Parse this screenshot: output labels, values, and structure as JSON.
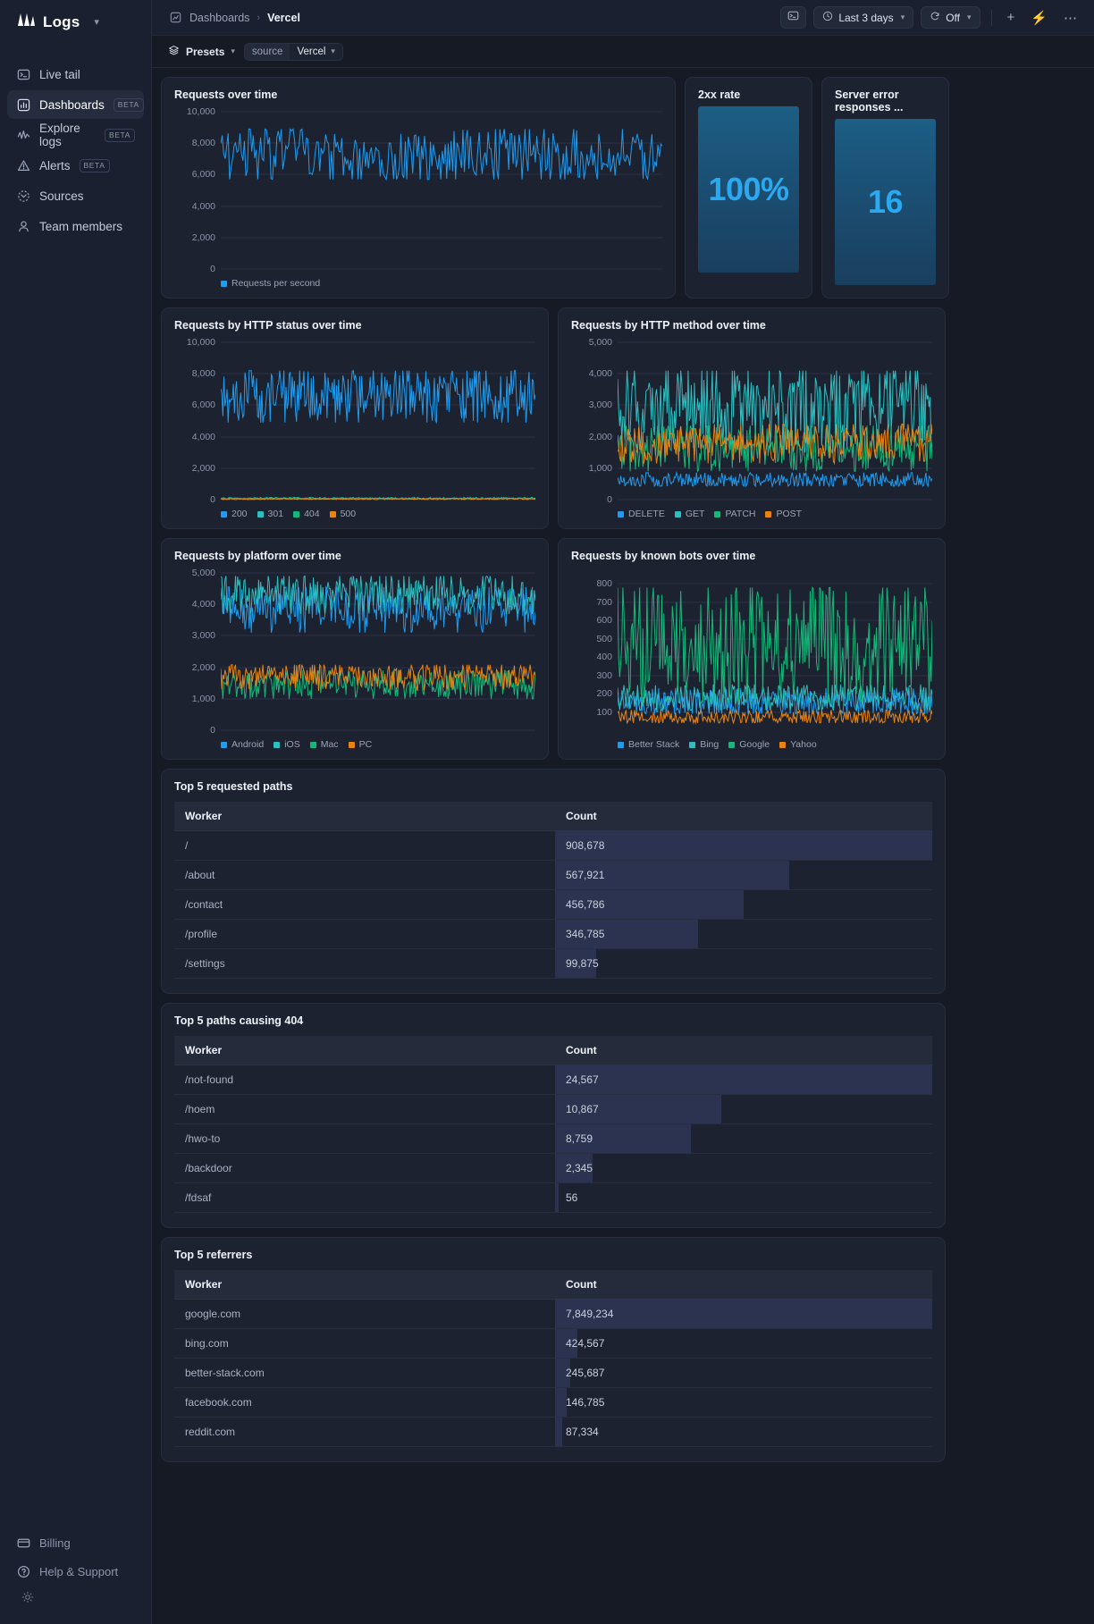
{
  "brand": {
    "name": "Logs",
    "caret": "chevron-down"
  },
  "sidebar": {
    "items": [
      {
        "label": "Live tail",
        "icon": "terminal-icon",
        "badge": "",
        "active": false
      },
      {
        "label": "Dashboards",
        "icon": "bar-chart-icon",
        "badge": "BETA",
        "active": true
      },
      {
        "label": "Explore logs",
        "icon": "activity-icon",
        "badge": "BETA",
        "active": false
      },
      {
        "label": "Alerts",
        "icon": "warning-triangle-icon",
        "badge": "BETA",
        "active": false
      },
      {
        "label": "Sources",
        "icon": "sources-icon",
        "badge": "",
        "active": false
      },
      {
        "label": "Team members",
        "icon": "user-icon",
        "badge": "",
        "active": false
      }
    ],
    "bottom": [
      {
        "label": "Billing",
        "icon": "credit-card-icon"
      },
      {
        "label": "Help & Support",
        "icon": "question-circle-icon"
      }
    ],
    "theme_toggle": "sun-icon"
  },
  "topbar": {
    "breadcrumb_root": "Dashboards",
    "breadcrumb_sep": "›",
    "breadcrumb_current": "Vercel",
    "console_button": "terminal-icon",
    "time_range": "Last 3 days",
    "refresh_label": "Off",
    "add_label": "+",
    "live_label": "⚡",
    "more_label": "⋯"
  },
  "filterbar": {
    "presets_label": "Presets",
    "filter_key": "source",
    "filter_value": "Vercel"
  },
  "chart_data": [
    {
      "id": "requests-over-time",
      "type": "line",
      "title": "Requests over time",
      "ylabel": "",
      "xlabel": "",
      "yticks": [
        10000,
        8000,
        6000,
        4000,
        2000,
        0
      ],
      "ytick_labels": [
        "10,000",
        "8,000",
        "6,000",
        "4,000",
        "2,000",
        "0"
      ],
      "ylim": [
        0,
        10000
      ],
      "grid": true,
      "legend_position": "bottom",
      "series": [
        {
          "name": "Requests per second",
          "color": "#1f9cf0",
          "mean": 7200,
          "min": 5700,
          "max": 8900
        }
      ]
    },
    {
      "id": "2xx-rate",
      "type": "number",
      "title": "2xx rate",
      "value": "100%",
      "value_color": "#2aa9f0"
    },
    {
      "id": "server-error-responses",
      "type": "number",
      "title": "Server error responses ...",
      "value": "16",
      "value_color": "#2aa9f0"
    },
    {
      "id": "requests-by-http-status",
      "type": "line",
      "title": "Requests by HTTP status over time",
      "yticks": [
        10000,
        8000,
        6000,
        4000,
        2000,
        0
      ],
      "ytick_labels": [
        "10,000",
        "8,000",
        "6,000",
        "4,000",
        "2,000",
        "0"
      ],
      "ylim": [
        0,
        10000
      ],
      "grid": true,
      "legend_position": "bottom",
      "series": [
        {
          "name": "200",
          "color": "#1f9cf0",
          "mean": 6700,
          "min": 4900,
          "max": 8200
        },
        {
          "name": "301",
          "color": "#2dbfc0",
          "mean": 60,
          "min": 20,
          "max": 110
        },
        {
          "name": "404",
          "color": "#14b87a",
          "mean": 90,
          "min": 30,
          "max": 150
        },
        {
          "name": "500",
          "color": "#e98413",
          "mean": 40,
          "min": 5,
          "max": 90
        }
      ]
    },
    {
      "id": "requests-by-http-method",
      "type": "line",
      "title": "Requests by HTTP method over time",
      "yticks": [
        5000,
        4000,
        3000,
        2000,
        1000,
        0
      ],
      "ytick_labels": [
        "5,000",
        "4,000",
        "3,000",
        "2,000",
        "1,000",
        "0"
      ],
      "ylim": [
        0,
        5000
      ],
      "grid": true,
      "legend_position": "bottom",
      "series": [
        {
          "name": "DELETE",
          "color": "#1f9cf0",
          "mean": 620,
          "min": 430,
          "max": 860
        },
        {
          "name": "GET",
          "color": "#2dbfc0",
          "mean": 2950,
          "min": 1500,
          "max": 4100
        },
        {
          "name": "PATCH",
          "color": "#14b87a",
          "mean": 1700,
          "min": 900,
          "max": 2350
        },
        {
          "name": "POST",
          "color": "#e98413",
          "mean": 1850,
          "min": 1150,
          "max": 2400
        }
      ]
    },
    {
      "id": "requests-by-platform",
      "type": "line",
      "title": "Requests by platform over time",
      "yticks": [
        5000,
        4000,
        3000,
        2000,
        1000,
        0
      ],
      "ytick_labels": [
        "5,000",
        "4,000",
        "3,000",
        "2,000",
        "1,000",
        "0"
      ],
      "ylim": [
        0,
        5000
      ],
      "grid": true,
      "legend_position": "bottom",
      "series": [
        {
          "name": "Android",
          "color": "#1f9cf0",
          "mean": 3850,
          "min": 3100,
          "max": 4550
        },
        {
          "name": "iOS",
          "color": "#2dbfc0",
          "mean": 4350,
          "min": 3700,
          "max": 4900
        },
        {
          "name": "Mac",
          "color": "#14b87a",
          "mean": 1450,
          "min": 1000,
          "max": 1900
        },
        {
          "name": "PC",
          "color": "#e98413",
          "mean": 1750,
          "min": 1250,
          "max": 2080
        }
      ]
    },
    {
      "id": "requests-by-known-bots",
      "type": "line",
      "title": "Requests by known bots over time",
      "yticks": [
        800,
        700,
        600,
        500,
        400,
        300,
        200,
        100
      ],
      "ytick_labels": [
        "800",
        "700",
        "600",
        "500",
        "400",
        "300",
        "200",
        "100"
      ],
      "ylim": [
        0,
        860
      ],
      "grid": true,
      "legend_position": "bottom",
      "series": [
        {
          "name": "Better Stack",
          "color": "#1f9cf0",
          "mean": 150,
          "min": 90,
          "max": 230
        },
        {
          "name": "Bing",
          "color": "#2dbfc0",
          "mean": 175,
          "min": 110,
          "max": 250
        },
        {
          "name": "Google",
          "color": "#14b87a",
          "mean": 480,
          "min": 150,
          "max": 780
        },
        {
          "name": "Yahoo",
          "color": "#e98413",
          "mean": 70,
          "min": 40,
          "max": 110
        }
      ]
    }
  ],
  "tables": [
    {
      "id": "top-5-requested-paths",
      "title": "Top 5 requested paths",
      "columns": [
        "Worker",
        "Count"
      ],
      "rows": [
        {
          "worker": "/",
          "count": "908,678",
          "pct": 100
        },
        {
          "worker": "/about",
          "count": "567,921",
          "pct": 62
        },
        {
          "worker": "/contact",
          "count": "456,786",
          "pct": 50
        },
        {
          "worker": "/profile",
          "count": "346,785",
          "pct": 38
        },
        {
          "worker": "/settings",
          "count": "99,875",
          "pct": 11
        }
      ]
    },
    {
      "id": "top-5-paths-causing-404",
      "title": "Top 5 paths causing 404",
      "columns": [
        "Worker",
        "Count"
      ],
      "rows": [
        {
          "worker": "/not-found",
          "count": "24,567",
          "pct": 100
        },
        {
          "worker": "/hoem",
          "count": "10,867",
          "pct": 44
        },
        {
          "worker": "/hwo-to",
          "count": "8,759",
          "pct": 36
        },
        {
          "worker": "/backdoor",
          "count": "2,345",
          "pct": 10
        },
        {
          "worker": "/fdsaf",
          "count": "56",
          "pct": 1
        }
      ]
    },
    {
      "id": "top-5-referrers",
      "title": "Top 5 referrers",
      "columns": [
        "Worker",
        "Count"
      ],
      "rows": [
        {
          "worker": "google.com",
          "count": "7,849,234",
          "pct": 100
        },
        {
          "worker": "bing.com",
          "count": "424,567",
          "pct": 6
        },
        {
          "worker": "better-stack.com",
          "count": "245,687",
          "pct": 4
        },
        {
          "worker": "facebook.com",
          "count": "146,785",
          "pct": 3
        },
        {
          "worker": "reddit.com",
          "count": "87,334",
          "pct": 2
        }
      ]
    }
  ]
}
